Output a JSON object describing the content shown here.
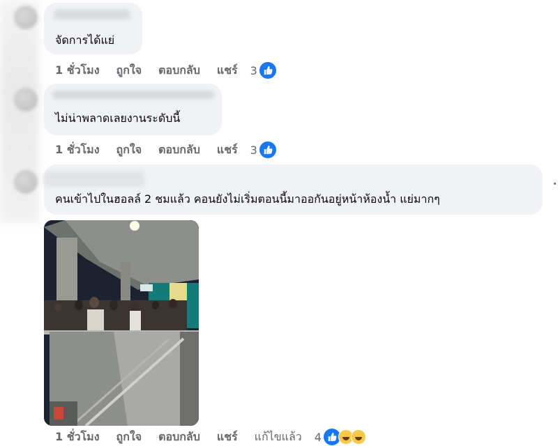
{
  "comments": [
    {
      "text": "จัดการได้แย่",
      "actions": {
        "time": "1 ชั่วโมง",
        "like": "ถูกใจ",
        "reply": "ตอบกลับ",
        "share": "แชร์"
      },
      "reaction_count": "3",
      "reactions": [
        "like-icon"
      ]
    },
    {
      "text": "ไม่น่าพลาดเลยงานระดับนี้",
      "actions": {
        "time": "1 ชั่วโมง",
        "like": "ถูกใจ",
        "reply": "ตอบกลับ",
        "share": "แชร์"
      },
      "reaction_count": "3",
      "reactions": [
        "like-icon"
      ]
    },
    {
      "text": "คนเข้าไปในฮอลล์ 2 ชมแล้ว คอนยังไม่เริ่มตอนนี้มาออกันอยู่หน้าห้องน้ำ แย่มากๆ",
      "has_photo": true,
      "actions": {
        "time": "1 ชั่วโมง",
        "like": "ถูกใจ",
        "reply": "ตอบกลับ",
        "share": "แชร์",
        "edited": "แก้ไขแล้ว"
      },
      "reaction_count": "4",
      "reactions": [
        "like-icon",
        "haha-icon",
        "care-icon"
      ]
    }
  ],
  "colors": {
    "bubble": "#f0f2f5",
    "action_text": "#65676b",
    "like_blue": "#1877f2"
  }
}
